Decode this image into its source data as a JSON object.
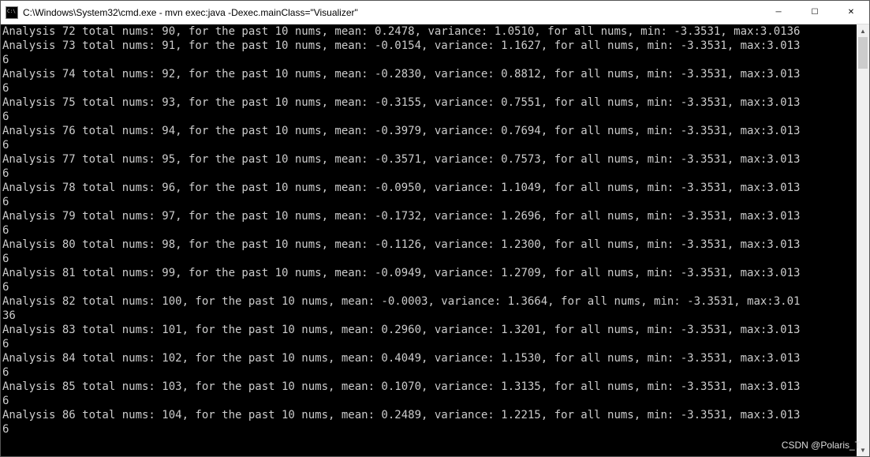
{
  "window": {
    "title": "C:\\Windows\\System32\\cmd.exe - mvn  exec:java -Dexec.mainClass=\"Visualizer\"",
    "icon": "cmd-icon",
    "minimize_label": "─",
    "maximize_label": "☐",
    "close_label": "✕"
  },
  "scrollbar": {
    "up": "▲",
    "down": "▼"
  },
  "watermark": "CSDN @Polaris_T",
  "common": {
    "past": ", for the past 10 nums, mean: ",
    "var": ", variance: ",
    "all": ", for all nums, min: ",
    "max": ", max:"
  },
  "lines": [
    {
      "pre": "Analysis 72 total nums: 90",
      "mean": "0.2478",
      "variance": "1.0510",
      "min": "-3.3531",
      "maxv": "3.0136",
      "wrap": ""
    },
    {
      "pre": "Analysis 73 total nums: 91",
      "mean": "-0.0154",
      "variance": "1.1627",
      "min": "-3.3531",
      "maxv": "3.013",
      "wrap": "6"
    },
    {
      "pre": "Analysis 74 total nums: 92",
      "mean": "-0.2830",
      "variance": "0.8812",
      "min": "-3.3531",
      "maxv": "3.013",
      "wrap": "6"
    },
    {
      "pre": "Analysis 75 total nums: 93",
      "mean": "-0.3155",
      "variance": "0.7551",
      "min": "-3.3531",
      "maxv": "3.013",
      "wrap": "6"
    },
    {
      "pre": "Analysis 76 total nums: 94",
      "mean": "-0.3979",
      "variance": "0.7694",
      "min": "-3.3531",
      "maxv": "3.013",
      "wrap": "6"
    },
    {
      "pre": "Analysis 77 total nums: 95",
      "mean": "-0.3571",
      "variance": "0.7573",
      "min": "-3.3531",
      "maxv": "3.013",
      "wrap": "6"
    },
    {
      "pre": "Analysis 78 total nums: 96",
      "mean": "-0.0950",
      "variance": "1.1049",
      "min": "-3.3531",
      "maxv": "3.013",
      "wrap": "6"
    },
    {
      "pre": "Analysis 79 total nums: 97",
      "mean": "-0.1732",
      "variance": "1.2696",
      "min": "-3.3531",
      "maxv": "3.013",
      "wrap": "6"
    },
    {
      "pre": "Analysis 80 total nums: 98",
      "mean": "-0.1126",
      "variance": "1.2300",
      "min": "-3.3531",
      "maxv": "3.013",
      "wrap": "6"
    },
    {
      "pre": "Analysis 81 total nums: 99",
      "mean": "-0.0949",
      "variance": "1.2709",
      "min": "-3.3531",
      "maxv": "3.013",
      "wrap": "6"
    },
    {
      "pre": "Analysis 82 total nums: 100",
      "mean": "-0.0003",
      "variance": "1.3664",
      "min": "-3.3531",
      "maxv": "3.01",
      "wrap": "36"
    },
    {
      "pre": "Analysis 83 total nums: 101",
      "mean": "0.2960",
      "variance": "1.3201",
      "min": "-3.3531",
      "maxv": "3.013",
      "wrap": "6"
    },
    {
      "pre": "Analysis 84 total nums: 102",
      "mean": "0.4049",
      "variance": "1.1530",
      "min": "-3.3531",
      "maxv": "3.013",
      "wrap": "6"
    },
    {
      "pre": "Analysis 85 total nums: 103",
      "mean": "0.1070",
      "variance": "1.3135",
      "min": "-3.3531",
      "maxv": "3.013",
      "wrap": "6"
    },
    {
      "pre": "Analysis 86 total nums: 104",
      "mean": "0.2489",
      "variance": "1.2215",
      "min": "-3.3531",
      "maxv": "3.013",
      "wrap": "6"
    }
  ]
}
